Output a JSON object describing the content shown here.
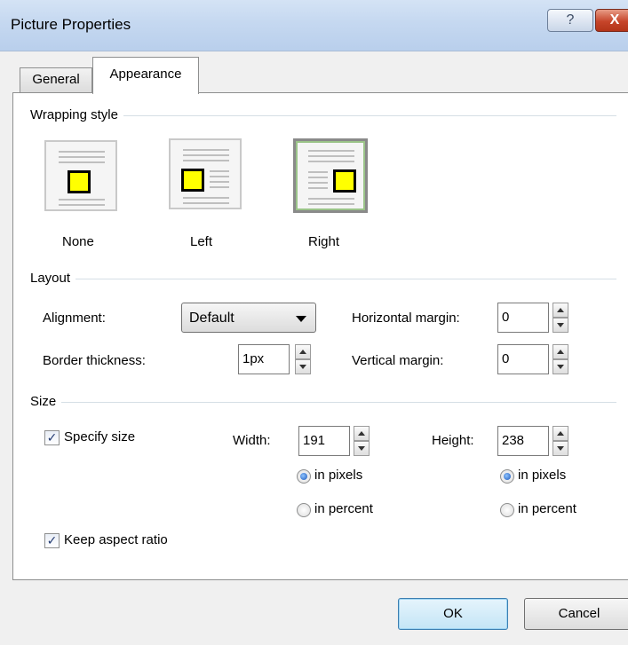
{
  "window": {
    "title": "Picture Properties",
    "help_label": "?",
    "close_label": "X"
  },
  "tabs": [
    {
      "label": "General",
      "active": false
    },
    {
      "label": "Appearance",
      "active": true
    }
  ],
  "wrapping": {
    "header": "Wrapping style",
    "options": [
      {
        "label": "None",
        "selected": false
      },
      {
        "label": "Left",
        "selected": false
      },
      {
        "label": "Right",
        "selected": true
      }
    ]
  },
  "layout": {
    "header": "Layout",
    "alignment_label": "Alignment:",
    "alignment_value": "Default",
    "border_label": "Border thickness:",
    "border_value": "1px",
    "hmargin_label": "Horizontal margin:",
    "hmargin_value": "0",
    "vmargin_label": "Vertical margin:",
    "vmargin_value": "0"
  },
  "size": {
    "header": "Size",
    "specify_label": "Specify size",
    "specify_checked": true,
    "width_label": "Width:",
    "width_value": "191",
    "height_label": "Height:",
    "height_value": "238",
    "pixels_label": "in pixels",
    "percent_label": "in percent",
    "width_unit": "pixels",
    "height_unit": "pixels",
    "aspect_label": "Keep aspect ratio",
    "aspect_checked": true
  },
  "buttons": {
    "ok": "OK",
    "cancel": "Cancel"
  },
  "colors": {
    "selected_border": "#9bc489",
    "picture_fill": "#ffff00"
  }
}
